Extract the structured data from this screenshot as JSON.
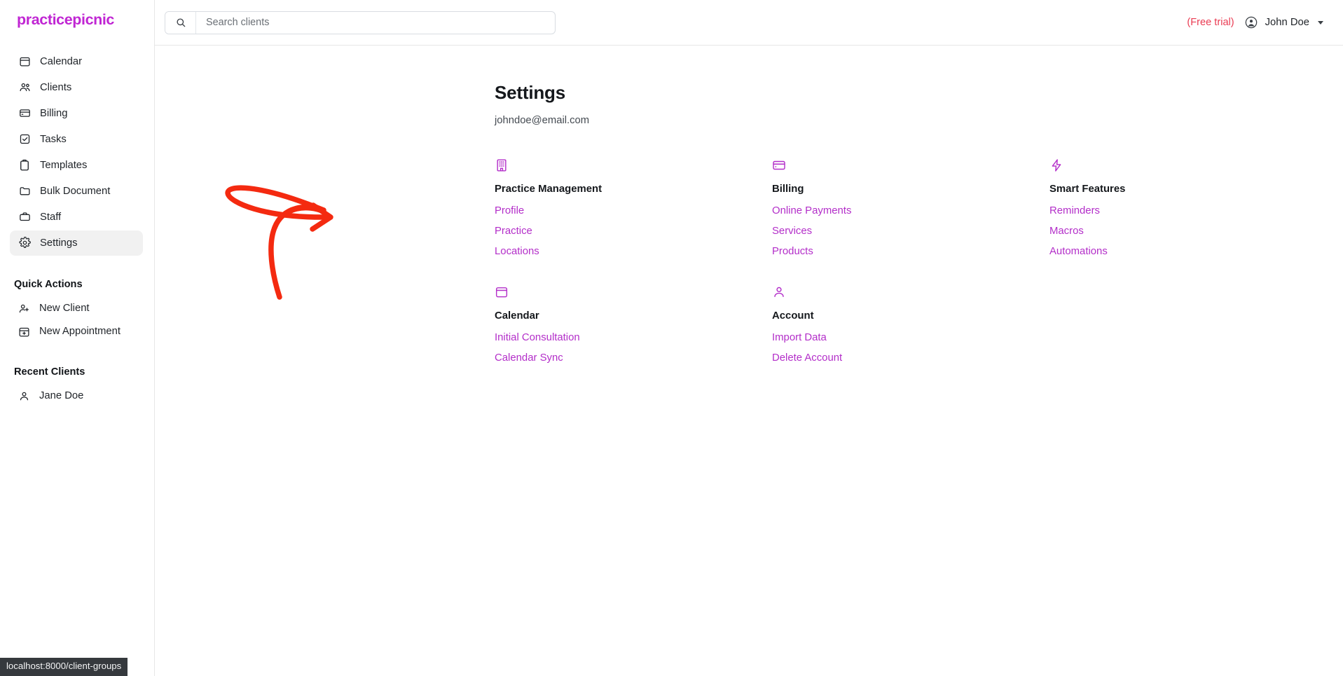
{
  "brand": {
    "logo_text": "practicepicnic",
    "logo_color": "#c026d3",
    "link_color": "#b32ec9",
    "trial_color": "#ea3b52"
  },
  "sidebar": {
    "nav_items": [
      {
        "label": "Calendar",
        "icon": "calendar-icon",
        "active": false
      },
      {
        "label": "Clients",
        "icon": "users-icon",
        "active": false
      },
      {
        "label": "Billing",
        "icon": "credit-card-icon",
        "active": false
      },
      {
        "label": "Tasks",
        "icon": "checkbox-icon",
        "active": false
      },
      {
        "label": "Templates",
        "icon": "clipboard-icon",
        "active": false
      },
      {
        "label": "Bulk Document",
        "icon": "folder-icon",
        "active": false
      },
      {
        "label": "Staff",
        "icon": "briefcase-icon",
        "active": false
      },
      {
        "label": "Settings",
        "icon": "gear-icon",
        "active": true
      }
    ],
    "quick_actions_label": "Quick Actions",
    "quick_actions": [
      {
        "label": "New Client",
        "icon": "user-plus-icon"
      },
      {
        "label": "New Appointment",
        "icon": "calendar-plus-icon"
      }
    ],
    "recent_clients_label": "Recent Clients",
    "recent_clients": [
      {
        "label": "Jane Doe",
        "icon": "user-icon"
      }
    ]
  },
  "topbar": {
    "search_placeholder": "Search clients",
    "search_value": "",
    "search_icon": "search-icon",
    "free_trial_label": "(Free trial)",
    "user_name": "John Doe",
    "avatar_icon": "avatar-icon",
    "caret_icon": "chevron-down-icon"
  },
  "page": {
    "title": "Settings",
    "subtitle": "johndoe@email.com"
  },
  "cards": [
    {
      "title": "Practice Management",
      "icon": "building-icon",
      "links": [
        "Profile",
        "Practice",
        "Locations"
      ]
    },
    {
      "title": "Billing",
      "icon": "credit-card-icon",
      "links": [
        "Online Payments",
        "Services",
        "Products"
      ]
    },
    {
      "title": "Smart Features",
      "icon": "lightning-bolt-icon",
      "links": [
        "Reminders",
        "Macros",
        "Automations"
      ]
    },
    {
      "title": "Calendar",
      "icon": "calendar-icon",
      "links": [
        "Initial Consultation",
        "Calendar Sync"
      ]
    },
    {
      "title": "Account",
      "icon": "user-icon",
      "links": [
        "Import Data",
        "Delete Account"
      ]
    }
  ],
  "annotation": {
    "type": "curved-arrow",
    "color": "#f42a10",
    "points_at": "Locations"
  },
  "statusbar": {
    "url": "localhost:8000/client-groups"
  }
}
